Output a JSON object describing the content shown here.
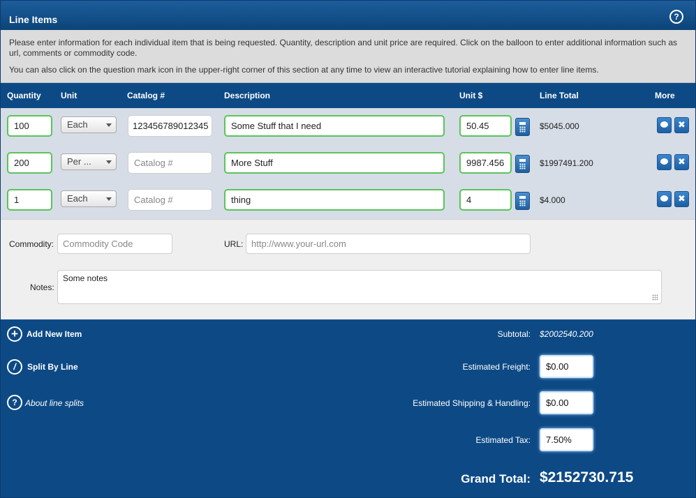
{
  "header": {
    "title": "Line Items",
    "help_glyph": "?"
  },
  "info": {
    "line1": "Please enter information for each individual item that is being requested. Quantity, description and unit price are required. Click on the balloon to enter additional information such as url, comments or commodity code.",
    "line2": "You can also click on the question mark icon in the upper-right corner of this section at any time to view an interactive tutorial explaining how to enter line items."
  },
  "columns": {
    "quantity": "Quantity",
    "unit": "Unit",
    "catalog": "Catalog #",
    "description": "Description",
    "unit_price": "Unit $",
    "line_total": "Line Total",
    "more": "More"
  },
  "rows": [
    {
      "quantity": "100",
      "unit": "Each",
      "catalog": "123456789012345",
      "description": "Some Stuff that I need",
      "unit_price": "50.45",
      "line_total": "$5045.000"
    },
    {
      "quantity": "200",
      "unit": "Per ...",
      "catalog": "",
      "description": "More Stuff",
      "unit_price": "9987.456",
      "line_total": "$1997491.200"
    },
    {
      "quantity": "1",
      "unit": "Each",
      "catalog": "",
      "description": "thing",
      "unit_price": "4",
      "line_total": "$4.000"
    }
  ],
  "catalog_placeholder": "Catalog #",
  "row_icons": {
    "comment": "speech-bubble-icon",
    "delete": "close-icon",
    "calc": "calculator-icon"
  },
  "details": {
    "commodity_label": "Commodity:",
    "commodity_placeholder": "Commodity Code",
    "url_label": "URL:",
    "url_placeholder": "http://www.your-url.com",
    "notes_label": "Notes:",
    "notes_value": "Some notes"
  },
  "footer": {
    "add_new_item": "Add New Item",
    "split_by_line": "Split By Line",
    "about_line_splits": "About line splits",
    "subtotal_label": "Subtotal:",
    "subtotal_value": "$2002540.200",
    "freight_label": "Estimated Freight:",
    "freight_value": "$0.00",
    "shipping_label": "Estimated Shipping & Handling:",
    "shipping_value": "$0.00",
    "tax_label": "Estimated Tax:",
    "tax_value": "7.50%",
    "grand_total_label": "Grand Total:",
    "grand_total_value": "$2152730.715"
  },
  "colors": {
    "brand_blue": "#0d4a85",
    "valid_green": "#5ac45a",
    "row_bg": "#d6dde6"
  }
}
